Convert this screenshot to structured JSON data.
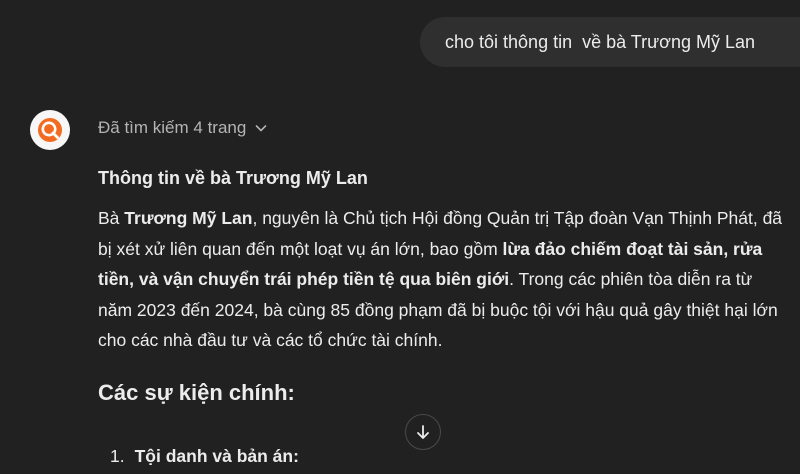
{
  "user_message": "cho tôi thông tin  về bà Trương Mỹ Lan",
  "assistant": {
    "avatar_icon": "search-logo-icon",
    "accent_color": "#f26b21",
    "search_status": "Đã tìm kiếm 4 trang",
    "heading": "Thông tin về bà Trương Mỹ Lan",
    "paragraph": {
      "p1": "Bà ",
      "b1": "Trương Mỹ Lan",
      "p2": ", nguyên là Chủ tịch Hội đồng Quản trị Tập đoàn Vạn Thịnh Phát, đã bị xét xử liên quan đến một loạt vụ án lớn, bao gồm ",
      "b2": "lừa đảo chiếm đoạt tài sản, rửa tiền, và vận chuyển trái phép tiền tệ qua biên giới",
      "p3": ". Trong các phiên tòa diễn ra từ năm 2023 đến 2024, bà cùng 85 đồng phạm đã bị buộc tội với hậu quả gây thiệt hại lớn cho các nhà đầu tư và các tổ chức tài chính."
    },
    "section_title": "Các sự kiện chính:",
    "list": [
      {
        "number": "1.",
        "title": "Tội danh và bản án:"
      }
    ]
  }
}
